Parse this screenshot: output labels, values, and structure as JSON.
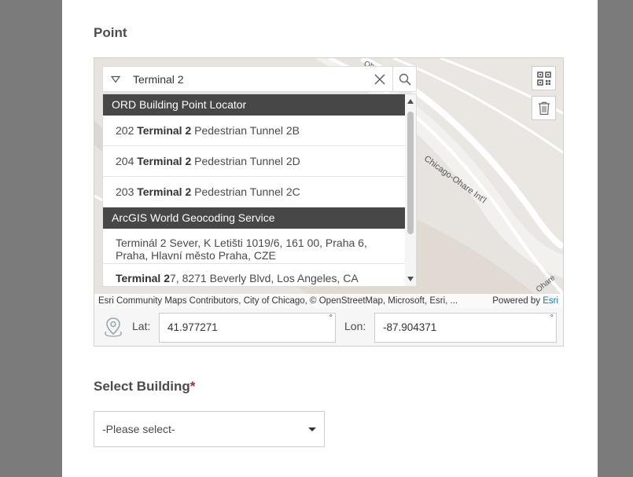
{
  "point_section": {
    "title": "Point"
  },
  "map": {
    "road_labels": [
      "Chicago-Ohare Int'l",
      "Ohare",
      "Ohare"
    ],
    "attribution": "Esri Community Maps Contributors, City of Chicago, © OpenStreetMap, Microsoft, Esri, ...",
    "powered_by": "Powered by",
    "esri_link": "Esri",
    "tools": {
      "select_icon": "qr-select-icon",
      "delete_icon": "trash-icon"
    }
  },
  "search": {
    "value": "Terminal 2",
    "groups": [
      {
        "header": "ORD Building Point Locator",
        "items": [
          {
            "prefix": "202 ",
            "match": "Terminal 2",
            "suffix": " Pedestrian Tunnel 2B"
          },
          {
            "prefix": "204 ",
            "match": "Terminal 2",
            "suffix": " Pedestrian Tunnel 2D"
          },
          {
            "prefix": "203 ",
            "match": "Terminal 2",
            "suffix": " Pedestrian Tunnel 2C"
          }
        ]
      },
      {
        "header": "ArcGIS World Geocoding Service",
        "items": [
          {
            "prefix": "",
            "match": "",
            "suffix": "Terminál 2 Sever, K Letišti 1019/6, 161 00, Praha 6, Praha, Hlavní město Praha, CZE"
          },
          {
            "prefix": "",
            "match": "Terminal 2",
            "suffix": "7, 8271 Beverly Blvd, Los Angeles, CA"
          }
        ]
      }
    ]
  },
  "coords": {
    "lat_label": "Lat:",
    "lat_value": "41.977271",
    "lon_label": "Lon:",
    "lon_value": "-87.904371",
    "degree": "°"
  },
  "building_section": {
    "title": "Select Building",
    "required_mark": "*",
    "select_value": "-Please select-"
  },
  "colors": {
    "group_header": "#474747",
    "accent_link": "#0079c1",
    "required": "#a82b2b"
  }
}
